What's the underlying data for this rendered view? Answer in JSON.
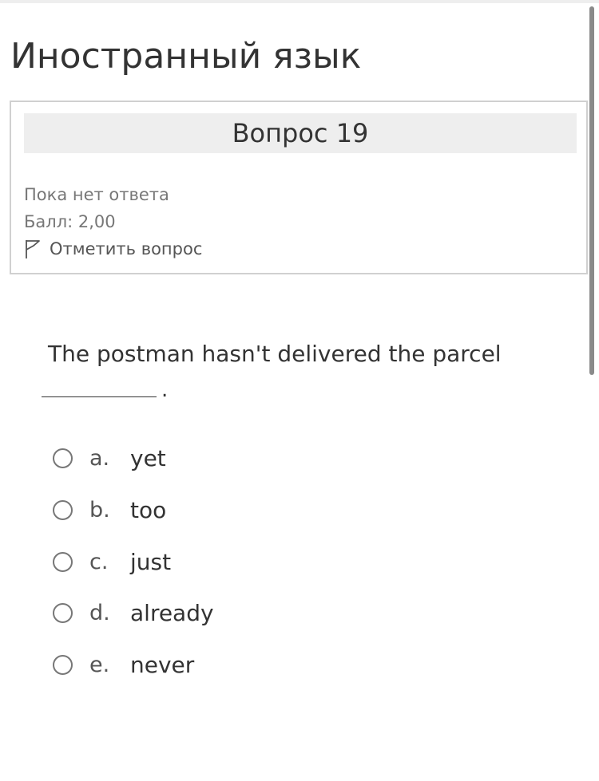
{
  "page": {
    "title": "Иностранный язык"
  },
  "question_info": {
    "header": "Вопрос 19",
    "status": "Пока нет ответа",
    "score": "Балл: 2,00",
    "flag_label": "Отметить вопрос"
  },
  "question": {
    "text": "The postman hasn't delivered the parcel",
    "trailing": ".",
    "options": [
      {
        "letter": "a.",
        "text": "yet",
        "selected": false
      },
      {
        "letter": "b.",
        "text": "too",
        "selected": false
      },
      {
        "letter": "c.",
        "text": "just",
        "selected": false
      },
      {
        "letter": "d.",
        "text": "already",
        "selected": false
      },
      {
        "letter": "e.",
        "text": "never",
        "selected": false
      }
    ]
  },
  "icons": {
    "flag": "flag-icon",
    "radio": "radio-unchecked-icon"
  },
  "colors": {
    "header_background": "#eeeeee",
    "card_border": "#d0d0d0",
    "muted_text": "#777777",
    "text": "#333333"
  }
}
